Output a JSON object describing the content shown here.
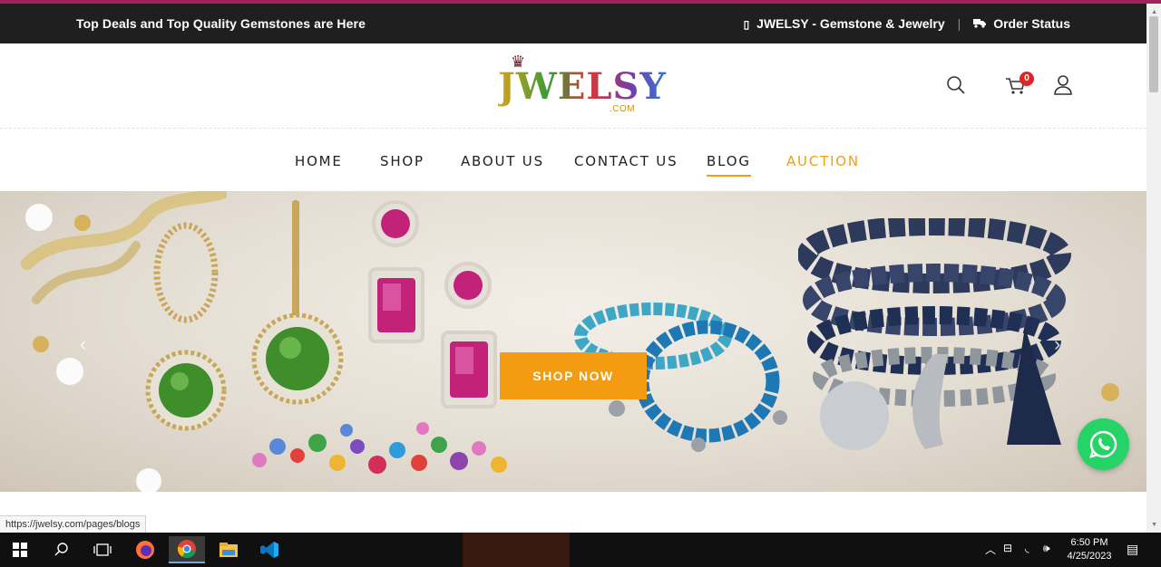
{
  "topbar": {
    "promo": "Top Deals and Top Quality Gemstones are Here",
    "brand_link": "JWELSY - Gemstone & Jewelry",
    "order_status": "Order Status"
  },
  "logo": {
    "mark": "JWELSY",
    "suffix": ".COM"
  },
  "header": {
    "cart_count": "0"
  },
  "nav": {
    "items": [
      {
        "label": "HOME"
      },
      {
        "label": "SHOP"
      },
      {
        "label": "ABOUT US"
      },
      {
        "label": "CONTACT US"
      },
      {
        "label": "BLOG"
      },
      {
        "label": "AUCTION"
      }
    ]
  },
  "hero": {
    "cta": "SHOP NOW"
  },
  "status_url": "https://jwelsy.com/pages/blogs",
  "taskbar": {
    "time": "6:50 PM",
    "date": "4/25/2023"
  },
  "colors": {
    "accent": "#f39c12",
    "topbar": "#1f1f1f",
    "badge": "#e02424",
    "whatsapp": "#25d366"
  }
}
